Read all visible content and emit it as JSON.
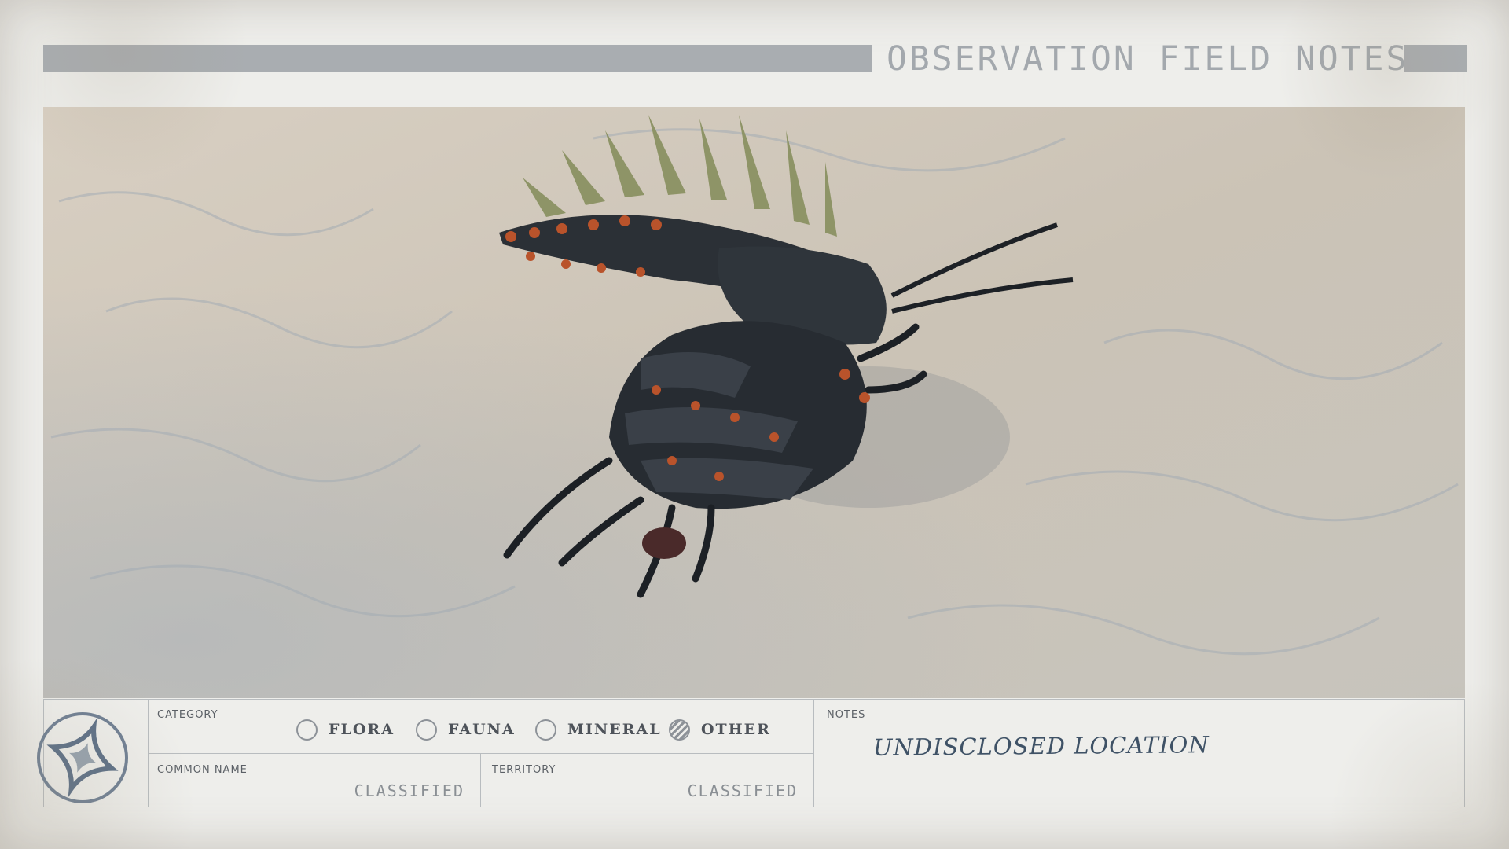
{
  "header": {
    "title": "OBSERVATION FIELD NOTES"
  },
  "photo": {
    "subject": "creature-on-snow"
  },
  "info": {
    "category_label": "CATEGORY",
    "categories": [
      {
        "label": "FLORA",
        "selected": false
      },
      {
        "label": "FAUNA",
        "selected": false
      },
      {
        "label": "MINERAL",
        "selected": false
      },
      {
        "label": "OTHER",
        "selected": true
      }
    ],
    "common_name_label": "COMMON NAME",
    "common_name_value": "CLASSIFIED",
    "territory_label": "TERRITORY",
    "territory_value": "CLASSIFIED",
    "notes_label": "NOTES",
    "notes_value": "UNDISCLOSED LOCATION"
  },
  "colors": {
    "paper": "#eeeeeb",
    "bar": "#a9adb1",
    "ink": "#3f5266",
    "snow": "#cfc6b8"
  }
}
